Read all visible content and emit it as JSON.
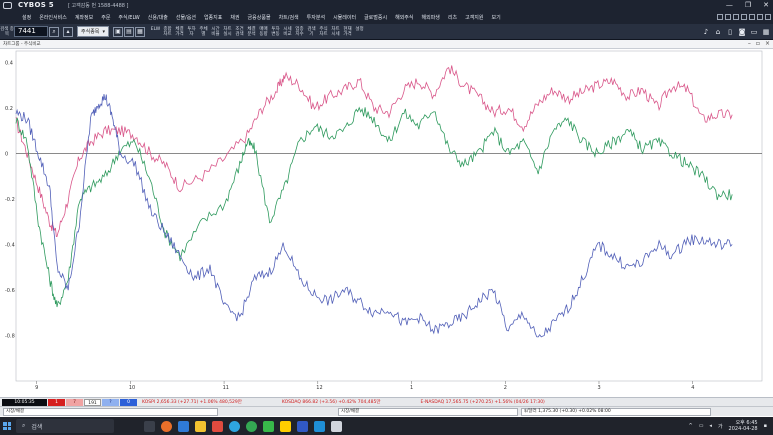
{
  "window": {
    "app_title": "CYBOS 5",
    "subtitle": "[ 고객감동 번 1588-4488 ]",
    "controls": [
      "—",
      "❐",
      "✕"
    ]
  },
  "menu": {
    "items": [
      "설정",
      "온라인서비스",
      "계좌정보",
      "주문",
      "주식/ELW",
      "신용/대출",
      "선물/옵션",
      "업종지표",
      "채권",
      "금융상품몰",
      "차트/검색",
      "투자분석",
      "시뮬레이터",
      "글로벌증시",
      "해외주식",
      "해외파생",
      "리츠",
      "고객지원",
      "보기"
    ]
  },
  "toolbar": {
    "left_label": "검색 종목",
    "code_value": "7441",
    "dropdown_value": "주식종목",
    "tools": [
      "ELW",
      "종합 차트",
      "체결 가격",
      "투자 자",
      "주체 별",
      "시간 비율",
      "차트 실시",
      "조건 검색",
      "체결 분석",
      "매매 동향",
      "투자 변동",
      "시세 비교",
      "업종 지수",
      "검색 기",
      "주식 차트",
      "차트 시세",
      "현재 가격",
      "설정"
    ]
  },
  "subbar": {
    "title": "차트그룹 - 주식비교"
  },
  "chart_data": {
    "type": "line",
    "y_ticks": [
      "0.4",
      "0.2",
      "0",
      "-0.2",
      "-0.4",
      "-0.6",
      "-0.8"
    ],
    "ylim": [
      -1.0,
      0.45
    ],
    "x_ticks": [
      "9",
      "10",
      "11",
      "12",
      "1",
      "2",
      "3",
      "4"
    ],
    "grid": false,
    "baseline": 0,
    "colors": {
      "pink": "#d9578a",
      "green": "#2f9a5e",
      "blue": "#5260b8",
      "baseline": "#444444"
    },
    "series": [
      {
        "color": "pink",
        "x": [
          0,
          0.015,
          0.03,
          0.045,
          0.055,
          0.07,
          0.085,
          0.1,
          0.12,
          0.14,
          0.16,
          0.18,
          0.2,
          0.22,
          0.25,
          0.28,
          0.31,
          0.33,
          0.35,
          0.36,
          0.38,
          0.4,
          0.42,
          0.44,
          0.46,
          0.48,
          0.5,
          0.52,
          0.54,
          0.56,
          0.58,
          0.6,
          0.62,
          0.64,
          0.66,
          0.68,
          0.7,
          0.72,
          0.74,
          0.76,
          0.78,
          0.8,
          0.82,
          0.84,
          0.86,
          0.88,
          0.9,
          0.92,
          0.94,
          0.96
        ],
        "y": [
          0.14,
          0.0,
          -0.15,
          -0.3,
          -0.36,
          -0.2,
          -0.02,
          0.05,
          0.1,
          0.1,
          0.08,
          0.0,
          -0.05,
          -0.15,
          -0.1,
          -0.02,
          0.08,
          0.2,
          0.28,
          0.34,
          0.3,
          0.2,
          0.25,
          0.28,
          0.32,
          0.2,
          0.18,
          0.28,
          0.32,
          0.26,
          0.38,
          0.3,
          0.25,
          0.18,
          0.2,
          0.12,
          0.22,
          0.28,
          0.24,
          0.27,
          0.3,
          0.32,
          0.25,
          0.28,
          0.2,
          0.3,
          0.28,
          0.15,
          0.17,
          0.17
        ]
      },
      {
        "color": "green",
        "x": [
          0,
          0.015,
          0.03,
          0.045,
          0.055,
          0.07,
          0.085,
          0.1,
          0.12,
          0.14,
          0.16,
          0.18,
          0.2,
          0.22,
          0.25,
          0.28,
          0.3,
          0.31,
          0.32,
          0.34,
          0.36,
          0.38,
          0.4,
          0.42,
          0.44,
          0.46,
          0.48,
          0.5,
          0.52,
          0.54,
          0.56,
          0.58,
          0.6,
          0.62,
          0.64,
          0.66,
          0.68,
          0.7,
          0.72,
          0.74,
          0.76,
          0.78,
          0.8,
          0.82,
          0.84,
          0.86,
          0.88,
          0.9,
          0.92,
          0.94,
          0.96
        ],
        "y": [
          0.15,
          0.05,
          -0.3,
          -0.55,
          -0.68,
          -0.55,
          -0.2,
          -0.15,
          -0.1,
          0.02,
          0.05,
          -0.12,
          -0.35,
          -0.45,
          -0.3,
          -0.22,
          -0.05,
          0.05,
          0.02,
          -0.3,
          -0.15,
          0.05,
          0.12,
          0.08,
          0.1,
          0.2,
          0.15,
          0.05,
          0.18,
          0.12,
          0.2,
          0.02,
          -0.05,
          0.0,
          0.1,
          0.0,
          0.05,
          -0.08,
          0.1,
          0.15,
          0.05,
          0.0,
          0.05,
          0.1,
          0.02,
          0.05,
          0.0,
          -0.05,
          -0.1,
          -0.18,
          -0.18
        ]
      },
      {
        "color": "blue",
        "x": [
          0,
          0.015,
          0.03,
          0.045,
          0.055,
          0.07,
          0.085,
          0.1,
          0.11,
          0.12,
          0.13,
          0.14,
          0.16,
          0.18,
          0.2,
          0.22,
          0.24,
          0.26,
          0.28,
          0.3,
          0.32,
          0.34,
          0.36,
          0.38,
          0.4,
          0.42,
          0.44,
          0.46,
          0.48,
          0.5,
          0.52,
          0.54,
          0.56,
          0.58,
          0.6,
          0.62,
          0.64,
          0.66,
          0.68,
          0.7,
          0.72,
          0.74,
          0.76,
          0.78,
          0.8,
          0.82,
          0.84,
          0.86,
          0.88,
          0.9,
          0.92,
          0.94,
          0.96
        ],
        "y": [
          0.18,
          0.15,
          0.0,
          -0.15,
          -0.5,
          -0.6,
          -0.3,
          0.15,
          0.22,
          0.25,
          0.15,
          0.0,
          -0.05,
          -0.25,
          -0.35,
          -0.45,
          -0.55,
          -0.5,
          -0.68,
          -0.72,
          -0.55,
          -0.52,
          -0.4,
          -0.55,
          -0.62,
          -0.65,
          -0.6,
          -0.65,
          -0.7,
          -0.68,
          -0.75,
          -0.72,
          -0.78,
          -0.75,
          -0.72,
          -0.65,
          -0.6,
          -0.78,
          -0.7,
          -0.82,
          -0.75,
          -0.68,
          -0.55,
          -0.4,
          -0.45,
          -0.5,
          -0.48,
          -0.4,
          -0.45,
          -0.38,
          -0.38,
          -0.4,
          -0.4
        ]
      }
    ]
  },
  "statusbar": {
    "time": "10:05:35",
    "boxes": [
      "1",
      "7",
      "191",
      "?",
      "0"
    ],
    "kospi": "KOSPI  2,656.33 (+27.71) +1.06% 480,529만",
    "kosdaq": "KOSDAQ  866.82 (+3.56) +0.42% 704,485만",
    "nasdaq": "E-NASDAQ  17,565.75 (+270.25) +1.56% (04/26 17:30)"
  },
  "statusbar2": {
    "left": "시장/채결",
    "right": "시장/채결",
    "fx": "$/달러  1,375.30 (+0.30) +0.02% 08:00"
  },
  "taskbar": {
    "search_placeholder": "검색",
    "clock_time": "오후 6:45",
    "clock_date": "2024-04-28",
    "ime": "가"
  }
}
